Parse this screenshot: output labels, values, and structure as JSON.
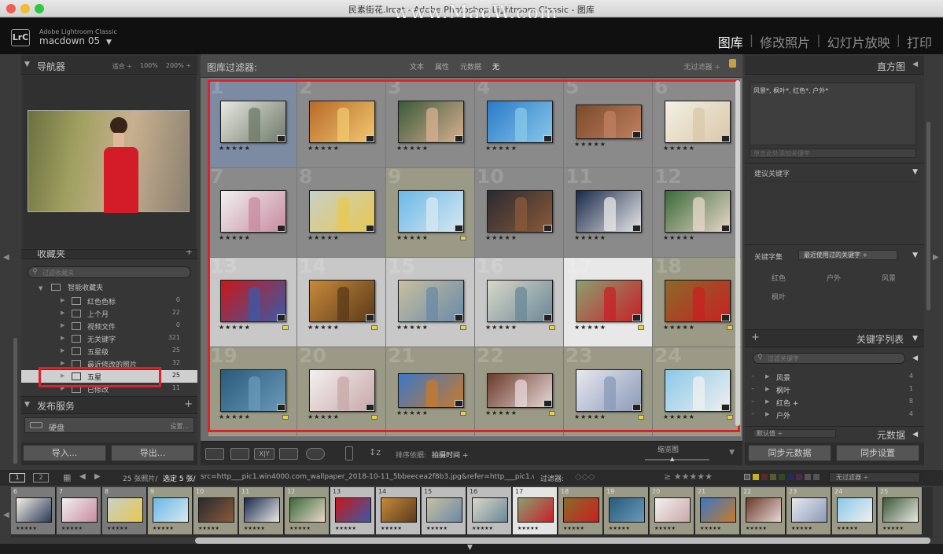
{
  "window": {
    "title": "民素街花.lrcat - Adobe Photoshop Lightroom Classic - 图库",
    "watermark": "www.MacW.com"
  },
  "identity": {
    "logo": "LrC",
    "brand": "Adobe Lightroom Classic",
    "catalog": "macdown 05",
    "catalog_caret": "▼"
  },
  "modules": [
    {
      "label": "图库",
      "active": true
    },
    {
      "label": "修改照片"
    },
    {
      "label": "幻灯片放映"
    },
    {
      "label": "打印"
    }
  ],
  "module_sep": "|",
  "navigator": {
    "title": "导航器",
    "zoom": [
      "适合 ÷",
      "100%",
      "200% ÷"
    ]
  },
  "collections": {
    "title": "收藏夹",
    "search_placeholder": "过滤收藏夹",
    "group": "智能收藏夹",
    "items": [
      {
        "label": "红色色标",
        "count": "0"
      },
      {
        "label": "上个月",
        "count": "22"
      },
      {
        "label": "视频文件",
        "count": "0"
      },
      {
        "label": "无关键字",
        "count": "321"
      },
      {
        "label": "五星级",
        "count": "25"
      },
      {
        "label": "最近修改的照片",
        "count": "32"
      },
      {
        "label": "五星",
        "count": "25",
        "selected": true
      },
      {
        "label": "已修改",
        "count": "11"
      }
    ]
  },
  "publish": {
    "title": "发布服务",
    "plus": "+",
    "service": "硬盘",
    "setup": "设置..."
  },
  "left_buttons": {
    "import": "导入...",
    "export": "导出..."
  },
  "filter": {
    "label": "图库过滤器:",
    "tabs": [
      "文本",
      "属性",
      "元数据",
      "无"
    ],
    "preset": "无过滤器 ÷"
  },
  "grid": {
    "stars": "★★★★★",
    "cells": [
      {
        "n": "1",
        "bg": "#7c8aa2",
        "a": "#e8e8e0",
        "b": "#6e7a6a",
        "w": 84,
        "h": 54
      },
      {
        "n": "2",
        "bg": "#8a8a8a",
        "a": "#b86a28",
        "b": "#f2c870",
        "w": 84,
        "h": 54
      },
      {
        "n": "3",
        "bg": "#8a8a8a",
        "a": "#3a5a3a",
        "b": "#d8b090",
        "w": 84,
        "h": 54
      },
      {
        "n": "4",
        "bg": "#8a8a8a",
        "a": "#2a7ac8",
        "b": "#88c8ea",
        "w": 84,
        "h": 54
      },
      {
        "n": "5",
        "bg": "#8a8a8a",
        "a": "#7a4a2a",
        "b": "#c08060",
        "w": 84,
        "h": 44
      },
      {
        "n": "6",
        "bg": "#8a8a8a",
        "a": "#f4f0e4",
        "b": "#d8c8a8",
        "w": 84,
        "h": 54
      },
      {
        "n": "7",
        "bg": "#8a8a8a",
        "a": "#f0f0f0",
        "b": "#c88aa0",
        "w": 84,
        "h": 54
      },
      {
        "n": "8",
        "bg": "#8a8a8a",
        "a": "#c8d0c8",
        "b": "#e8c850",
        "w": 84,
        "h": 54
      },
      {
        "n": "9",
        "bg": "#9a9a86",
        "a": "#6ab8e8",
        "b": "#d8e8f0",
        "w": 84,
        "h": 54
      },
      {
        "n": "10",
        "bg": "#8a8a8a",
        "a": "#2a2a30",
        "b": "#8a5a3a",
        "w": 84,
        "h": 54
      },
      {
        "n": "11",
        "bg": "#8a8a8a",
        "a": "#1a2a4a",
        "b": "#e8e8e8",
        "w": 84,
        "h": 54
      },
      {
        "n": "12",
        "bg": "#8a8a8a",
        "a": "#3a6a3a",
        "b": "#e8d8c8",
        "w": 84,
        "h": 54
      },
      {
        "n": "13",
        "bg": "#c8c8c8",
        "a": "#c81818",
        "b": "#3a5aa8",
        "w": 84,
        "h": 54
      },
      {
        "n": "14",
        "bg": "#c8c8c8",
        "a": "#c88a3a",
        "b": "#5a3a1a",
        "w": 84,
        "h": 54
      },
      {
        "n": "15",
        "bg": "#c8c8c8",
        "a": "#c8c0a0",
        "b": "#6a8aa8",
        "w": 84,
        "h": 54
      },
      {
        "n": "16",
        "bg": "#c8c8c8",
        "a": "#d8d8c8",
        "b": "#6a8898",
        "w": 84,
        "h": 54
      },
      {
        "n": "17",
        "bg": "#e8e8e8",
        "a": "#8aa070",
        "b": "#c82028",
        "w": 84,
        "h": 54
      },
      {
        "n": "18",
        "bg": "#9a9a86",
        "a": "#8a6a2a",
        "b": "#c82020",
        "w": 84,
        "h": 54
      },
      {
        "n": "19",
        "bg": "#9a9a86",
        "a": "#2a5a7a",
        "b": "#6a9ab8",
        "w": 84,
        "h": 54
      },
      {
        "n": "20",
        "bg": "#9a9a86",
        "a": "#f4f0f0",
        "b": "#c8a8a8",
        "w": 84,
        "h": 54
      },
      {
        "n": "21",
        "bg": "#9a9a86",
        "a": "#3a78c8",
        "b": "#c87a2a",
        "w": 84,
        "h": 44
      },
      {
        "n": "22",
        "bg": "#9a9a86",
        "a": "#6a3a2a",
        "b": "#e8d8d8",
        "w": 84,
        "h": 44
      },
      {
        "n": "23",
        "bg": "#9a9a86",
        "a": "#e8e8f0",
        "b": "#8a9ab8",
        "w": 84,
        "h": 54
      },
      {
        "n": "24",
        "bg": "#9a9a86",
        "a": "#8ac8e8",
        "b": "#f0f0f0",
        "w": 84,
        "h": 54
      }
    ]
  },
  "toolbar": {
    "sort_label": "排序依据:",
    "sort_value": "拍摄时间 ÷",
    "thumb_label": "缩览图",
    "xy": "X|Y"
  },
  "right": {
    "histogram": "直方图",
    "keywords_applied": "风景*, 枫叶*, 红色*, 户外*",
    "keyword_placeholder": "单击此处添加关键字",
    "suggestions": "建议关键字",
    "keyword_set_label": "关键字集",
    "keyword_set_value": "最近使用过的关键字 ÷",
    "set_items": [
      "红色",
      "户外",
      "风景",
      "枫叶"
    ],
    "keyword_list": "关键字列表",
    "keyword_filter_placeholder": "过滤关键字",
    "list": [
      {
        "label": "风景",
        "count": "4"
      },
      {
        "label": "枫叶",
        "count": "1"
      },
      {
        "label": "红色 +",
        "count": "8"
      },
      {
        "label": "户外",
        "count": "4"
      }
    ],
    "default_label": "默认值 ÷",
    "metadata": "元数据",
    "sync_meta": "同步元数据",
    "sync_settings": "同步设置"
  },
  "stripbar": {
    "page1": "1",
    "page2": "2",
    "info_count": "25 张照片/",
    "info_sel": "选定 5 张/",
    "info_file": "src=http___pic1.win4000.com_wallpaper_2018-10-11_5bbeecea2f8b3.jpg&refer=http___pic1.win4000.",
    "filter_label": "过滤器:",
    "rating_op": "≥ ★★★★★",
    "filter_preset": "无过滤器 ÷"
  },
  "filmstrip": {
    "stars": "★★★★★",
    "cells": [
      {
        "n": "6",
        "a": "#f4f0e4",
        "b": "#2a3a5a"
      },
      {
        "n": "7",
        "a": "#f0f0f0",
        "b": "#c88aa0"
      },
      {
        "n": "8",
        "a": "#c8d0c8",
        "b": "#e8c850"
      },
      {
        "n": "9",
        "a": "#6ab8e8",
        "b": "#d8e8f0"
      },
      {
        "n": "10",
        "a": "#2a2a30",
        "b": "#8a5a3a"
      },
      {
        "n": "11",
        "a": "#1a2a4a",
        "b": "#e8e8e8"
      },
      {
        "n": "12",
        "a": "#3a6a3a",
        "b": "#e8d8c8"
      },
      {
        "n": "13",
        "a": "#c81818",
        "b": "#3a5aa8"
      },
      {
        "n": "14",
        "a": "#c88a3a",
        "b": "#5a3a1a"
      },
      {
        "n": "15",
        "a": "#c8c0a0",
        "b": "#6a8aa8"
      },
      {
        "n": "16",
        "a": "#d8d8c8",
        "b": "#6a8898"
      },
      {
        "n": "17",
        "a": "#8aa070",
        "b": "#c82028"
      },
      {
        "n": "18",
        "a": "#8a6a2a",
        "b": "#c82020"
      },
      {
        "n": "19",
        "a": "#2a5a7a",
        "b": "#6a9ab8"
      },
      {
        "n": "20",
        "a": "#f4f0f0",
        "b": "#c8a8a8"
      },
      {
        "n": "21",
        "a": "#3a78c8",
        "b": "#c87a2a"
      },
      {
        "n": "22",
        "a": "#6a3a2a",
        "b": "#e8d8d8"
      },
      {
        "n": "23",
        "a": "#e8e8f0",
        "b": "#8a9ab8"
      },
      {
        "n": "24",
        "a": "#8ac8e8",
        "b": "#f0f0f0"
      },
      {
        "n": "25",
        "a": "#3a5a3a",
        "b": "#e8e8e0"
      }
    ]
  },
  "colors": {
    "accent_red": "#e0202a",
    "flag_yellow": "#e4d24a"
  }
}
